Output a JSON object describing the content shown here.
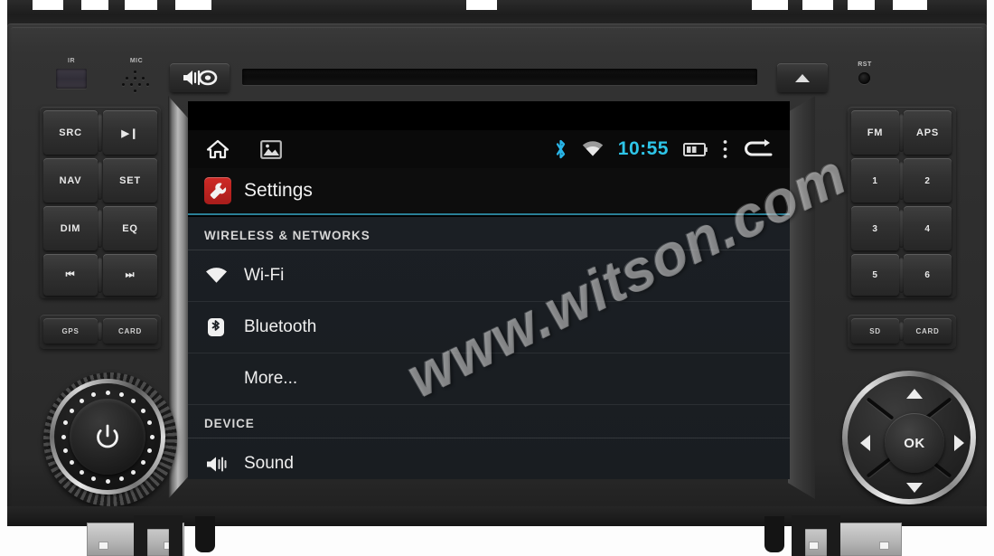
{
  "device": {
    "name": "car-dvd-head-unit",
    "ir_label": "IR",
    "mic_label": "MIC",
    "rst_label": "RST",
    "mute_icon": "speaker-mute-icon",
    "eject_icon": "eject-icon",
    "disc_slot": "disc-slot"
  },
  "left_buttons": [
    {
      "label": "SRC",
      "name": "source-button"
    },
    {
      "label": "▶❙",
      "name": "play-pause-button"
    },
    {
      "label": "NAV",
      "name": "navigation-button"
    },
    {
      "label": "SET",
      "name": "settings-button"
    },
    {
      "label": "DIM",
      "name": "dimmer-button"
    },
    {
      "label": "EQ",
      "name": "equalizer-button"
    },
    {
      "label": "⏮",
      "name": "previous-track-button"
    },
    {
      "label": "⏭",
      "name": "next-track-button"
    }
  ],
  "left_slots": [
    {
      "label": "GPS",
      "name": "gps-slot"
    },
    {
      "label": "CARD",
      "name": "card-slot-left"
    }
  ],
  "right_buttons": [
    {
      "label": "FM",
      "name": "fm-band-button"
    },
    {
      "label": "APS",
      "name": "aps-button"
    },
    {
      "label": "1",
      "name": "preset-1-button"
    },
    {
      "label": "2",
      "name": "preset-2-button"
    },
    {
      "label": "3",
      "name": "preset-3-button"
    },
    {
      "label": "4",
      "name": "preset-4-button"
    },
    {
      "label": "5",
      "name": "preset-5-button"
    },
    {
      "label": "6",
      "name": "preset-6-button"
    }
  ],
  "right_slots": [
    {
      "label": "SD",
      "name": "sd-slot"
    },
    {
      "label": "CARD",
      "name": "card-slot-right"
    }
  ],
  "volume_knob": {
    "name": "volume-power-knob",
    "icon": "power-icon"
  },
  "dpad": {
    "ok_label": "OK",
    "up": "up-arrow-icon",
    "down": "down-arrow-icon",
    "left": "left-arrow-icon",
    "right": "right-arrow-icon"
  },
  "screen": {
    "statusbar": {
      "home_icon": "home-icon",
      "gallery_icon": "gallery-icon",
      "bluetooth_icon": "bluetooth-icon",
      "wifi_icon": "wifi-icon",
      "time": "10:55",
      "battery_icon": "battery-icon",
      "overflow_icon": "more-vertical-icon",
      "back_icon": "back-arrow-icon",
      "accent_color": "#2ec5e8"
    },
    "header": {
      "title": "Settings",
      "icon": "settings-wrench-icon",
      "icon_color": "#cf2a26",
      "underline_color": "#2a7f96"
    },
    "sections": [
      {
        "header": "WIRELESS & NETWORKS",
        "rows": [
          {
            "label": "Wi-Fi",
            "icon": "wifi-icon",
            "indent": false
          },
          {
            "label": "Bluetooth",
            "icon": "bluetooth-icon",
            "indent": false
          },
          {
            "label": "More...",
            "icon": "",
            "indent": true
          }
        ]
      },
      {
        "header": "DEVICE",
        "rows": [
          {
            "label": "Sound",
            "icon": "sound-icon",
            "indent": false
          }
        ]
      }
    ]
  },
  "watermark": {
    "text": "www.witson.com"
  }
}
